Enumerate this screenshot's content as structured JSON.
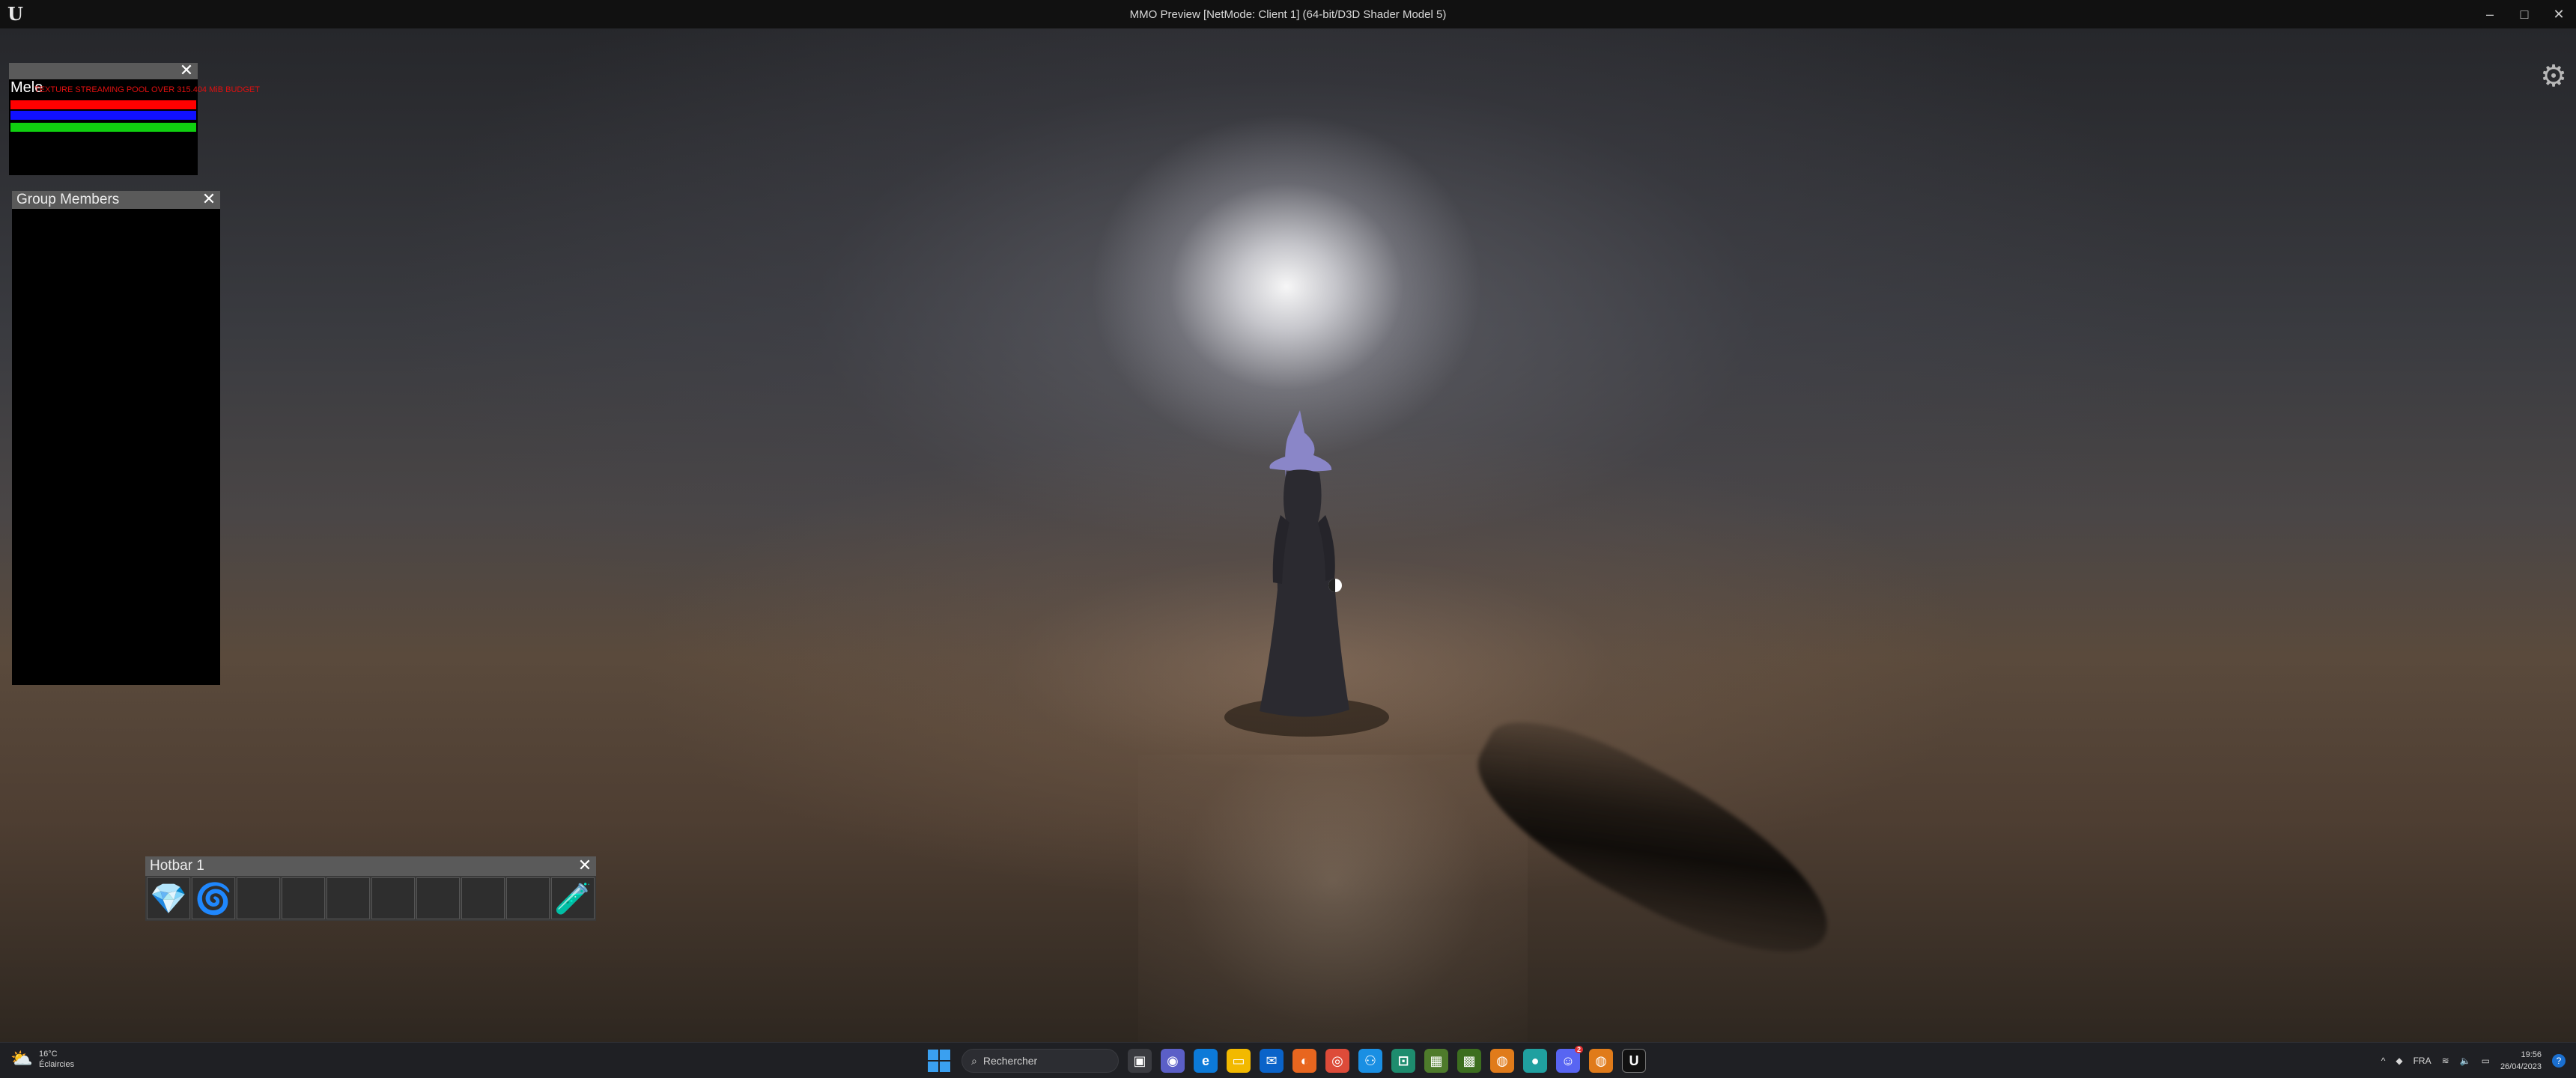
{
  "window": {
    "title": "MMO Preview [NetMode: Client 1]  (64-bit/D3D Shader Model 5)",
    "controls": [
      "–",
      "□",
      "✕"
    ]
  },
  "target_frame": {
    "name": "Mele",
    "warning": "TEXTURE STREAMING POOL OVER 315.404 MiB BUDGET",
    "health_pct": 100,
    "mana_pct": 100,
    "stamina_pct": 100,
    "colors": {
      "health": "#ff0000",
      "mana": "#1010ff",
      "stamina": "#10d010"
    }
  },
  "group_panel": {
    "title": "Group Members"
  },
  "hotbar": {
    "title": "Hotbar 1",
    "slots": [
      {
        "icon": "crystal-heart-icon",
        "glyph": "💎"
      },
      {
        "icon": "golden-swirl-icon",
        "glyph": "🌀"
      },
      {
        "icon": "",
        "glyph": ""
      },
      {
        "icon": "",
        "glyph": ""
      },
      {
        "icon": "",
        "glyph": ""
      },
      {
        "icon": "",
        "glyph": ""
      },
      {
        "icon": "",
        "glyph": ""
      },
      {
        "icon": "",
        "glyph": ""
      },
      {
        "icon": "",
        "glyph": ""
      },
      {
        "icon": "green-potion-icon",
        "glyph": "🧪"
      }
    ]
  },
  "taskbar": {
    "weather": {
      "temp": "16°C",
      "condition": "Éclaircies"
    },
    "search_placeholder": "Rechercher",
    "language": "FRA",
    "time": "19:56",
    "date": "26/04/2023",
    "notification_count": "2"
  }
}
